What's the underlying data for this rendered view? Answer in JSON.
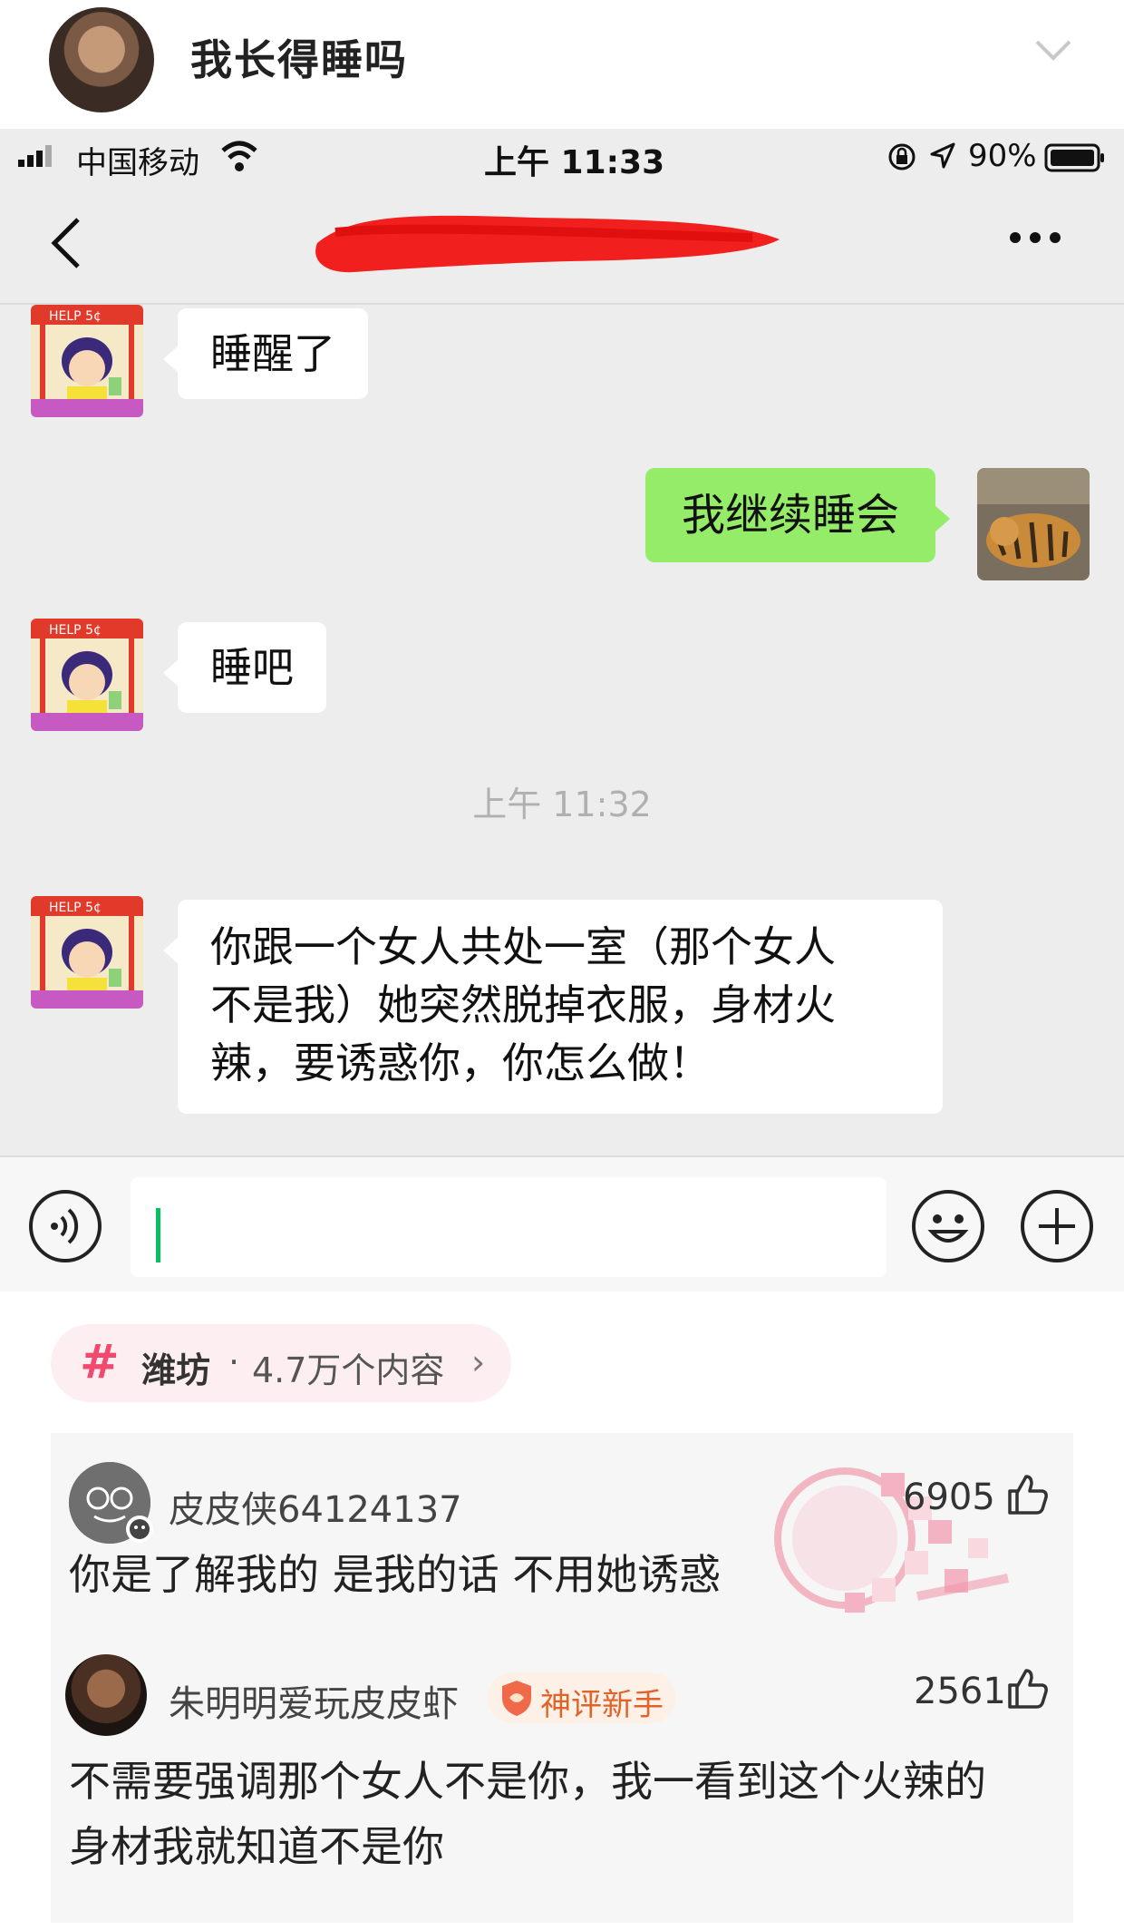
{
  "post": {
    "title": "我长得睡吗"
  },
  "status_bar": {
    "carrier": "中国移动",
    "time": "上午 11:33",
    "battery": "90%"
  },
  "chat": {
    "messages": [
      {
        "side": "left",
        "text": "睡醒了"
      },
      {
        "side": "right",
        "text": "我继续睡会"
      },
      {
        "side": "left",
        "text": "睡吧"
      },
      {
        "side": "left",
        "text_lines": [
          "你跟一个女人共处一室（那个女人",
          "不是我）她突然脱掉衣服，身材火",
          "辣，要诱惑你，你怎么做！"
        ]
      }
    ],
    "timestamp": "上午 11:32",
    "avatar_sign_text": "HELP 5¢"
  },
  "topic": {
    "hash": "#",
    "name": "潍坊",
    "dot": "·",
    "count": "4.7万个内容",
    "arrow": "›"
  },
  "comments": [
    {
      "user": "皮皮侠64124137",
      "likes": "6905",
      "text": "你是了解我的 是我的话 不用她诱惑"
    },
    {
      "user": "朱明明爱玩皮皮虾",
      "badge": "神评新手",
      "likes": "2561",
      "text_lines": [
        "不需要强调那个女人不是你，我一看到这个火辣的",
        "身材我就知道不是你"
      ]
    }
  ],
  "colors": {
    "wechat_green_bubble": "#95ec69",
    "chat_bg": "#ededed",
    "topic_pink": "#f14a6e",
    "badge_orange": "#e0632a",
    "redaction_red": "#f21f1f"
  }
}
